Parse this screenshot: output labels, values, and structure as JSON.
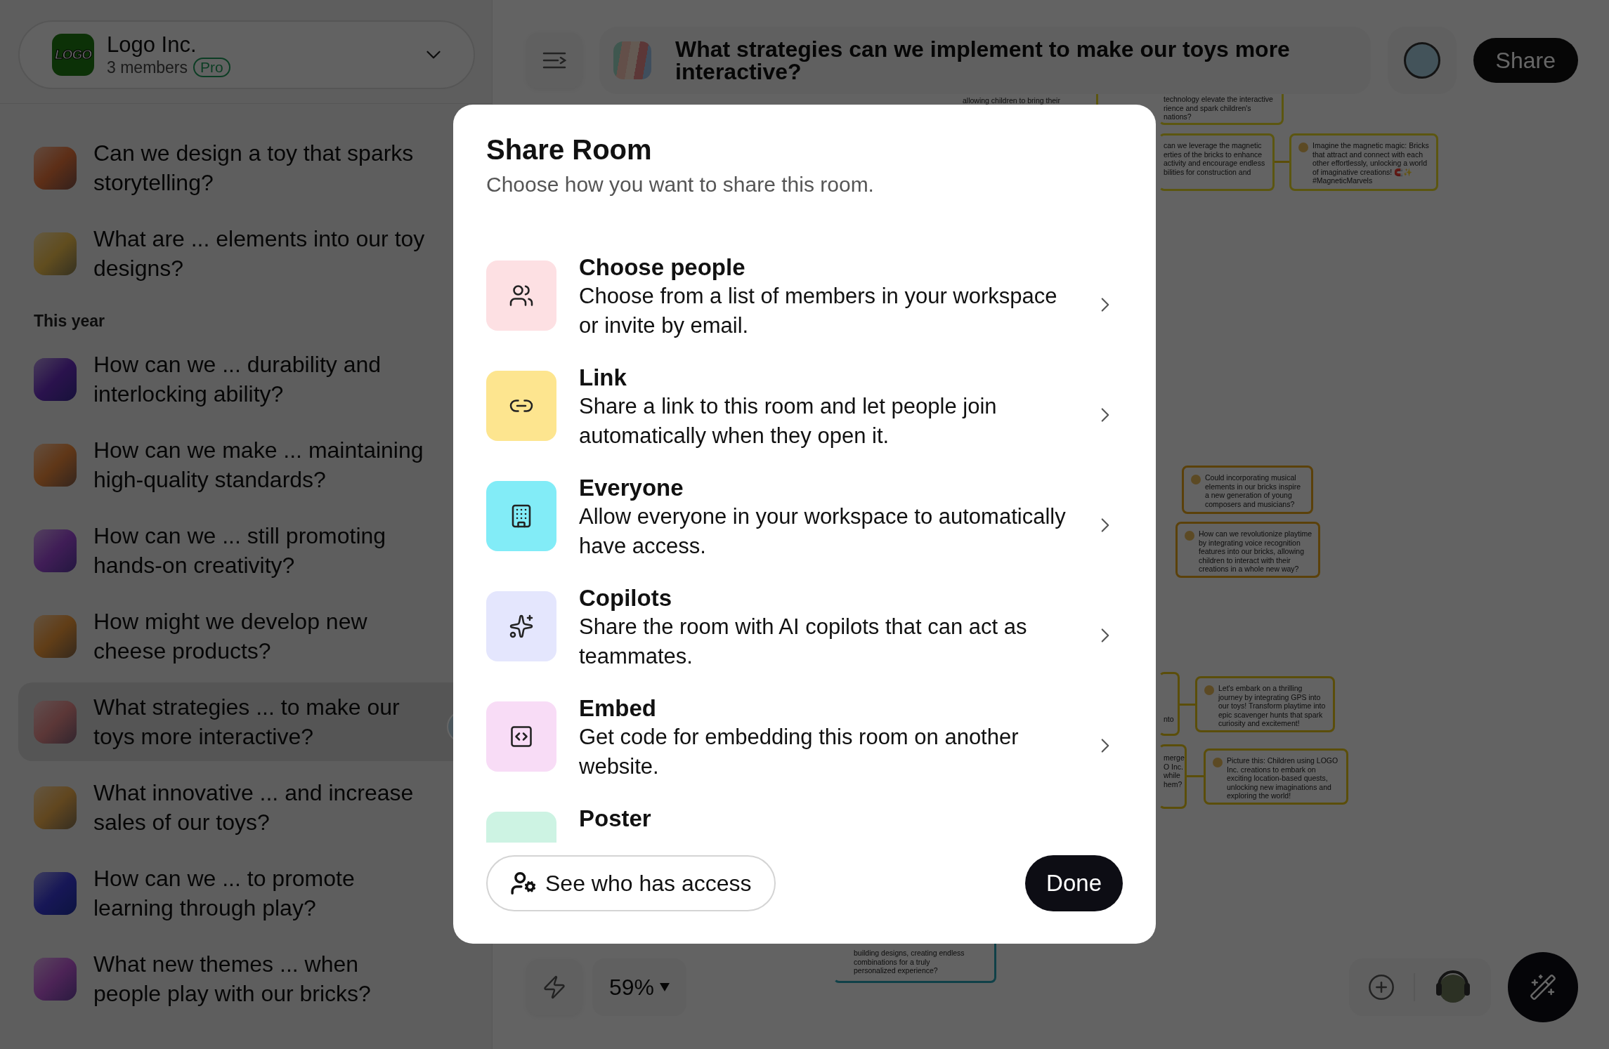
{
  "workspace": {
    "logo_text": "LOGO",
    "name": "Logo Inc.",
    "members": "3 members",
    "plan": "Pro"
  },
  "sidebar": {
    "sections": [
      {
        "items": [
          {
            "title": "Can we design a toy that sparks storytelling?",
            "selected": false
          },
          {
            "title": "What are ... elements into our toy designs?",
            "selected": false
          }
        ]
      },
      {
        "label": "This year",
        "items": [
          {
            "title": "How can we ... durability and interlocking ability?",
            "selected": false
          },
          {
            "title": "How can we make ... maintaining high-quality standards?",
            "selected": false
          },
          {
            "title": "How can we ... still promoting hands-on creativity?",
            "selected": false
          },
          {
            "title": "How might we develop new cheese products?",
            "selected": false
          },
          {
            "title": "What strategies ... to make our toys more interactive?",
            "selected": true
          },
          {
            "title": "What innovative ... and increase sales of our toys?",
            "selected": false
          },
          {
            "title": "How can we ... to promote learning through play?",
            "selected": false
          },
          {
            "title": "What new themes ... when people play with our bricks?",
            "selected": false
          }
        ]
      }
    ]
  },
  "header": {
    "title": "What strategies can we implement to make our toys more interactive?",
    "share": "Share"
  },
  "canvas": {
    "nodes": [
      {
        "kind": "fragment",
        "lines": [
          "allowing children to bring their"
        ]
      },
      {
        "kind": "fragment",
        "lines": [
          "technology elevate the interactive",
          "rience and spark children's",
          "nations?"
        ]
      },
      {
        "kind": "fragment",
        "lines": [
          "can we leverage the magnetic",
          "erties of the bricks to enhance",
          "activity and encourage endless",
          "bilities for construction and"
        ]
      },
      {
        "kind": "idea",
        "lines": [
          "Imagine the magnetic magic: Bricks that attract and connect with each other effortlessly, unlocking a world of imaginative creations! 🧲✨ #MagneticMarvels"
        ]
      },
      {
        "kind": "idea",
        "lines": [
          "Could incorporating musical elements in our bricks inspire a new generation of young composers and musicians?"
        ]
      },
      {
        "kind": "idea",
        "lines": [
          "How can we revolutionize playtime by integrating voice recognition features into our bricks, allowing children to interact with their creations in a whole new way?"
        ]
      },
      {
        "kind": "fragment",
        "lines": [
          "nto"
        ]
      },
      {
        "kind": "fragment",
        "lines": [
          "merge",
          "O Inc.",
          "while",
          "hem?"
        ]
      },
      {
        "kind": "idea",
        "lines": [
          "Let's embark on a thrilling journey by integrating GPS into our toys! Transform playtime into epic scavenger hunts that spark curiosity and excitement!"
        ]
      },
      {
        "kind": "idea",
        "lines": [
          "Picture this: Children using LOGO Inc. creations to embark on exciting location-based quests, unlocking new imaginations and exploring the world!"
        ]
      },
      {
        "kind": "fragment",
        "lines": [
          "building designs, creating endless",
          "combinations for a truly",
          "personalized experience?"
        ]
      }
    ],
    "zoom": "59%"
  },
  "dialog": {
    "title": "Share Room",
    "subtitle": "Choose how you want to share this room.",
    "options": [
      {
        "title": "Choose people",
        "description": "Choose from a list of members in your workspace or invite by email.",
        "color": "#fde0e3"
      },
      {
        "title": "Link",
        "description": "Share a link to this room and let people join automatically when they open it.",
        "color": "#fde58f"
      },
      {
        "title": "Everyone",
        "description": "Allow everyone in your workspace to automatically have access.",
        "color": "#82ecf7"
      },
      {
        "title": "Copilots",
        "description": "Share the room with AI copilots that can act as teammates.",
        "color": "#e4e6fd"
      },
      {
        "title": "Embed",
        "description": "Get code for embedding this room on another website.",
        "color": "#f8dcf6"
      },
      {
        "title": "Poster",
        "color": "#cdf3e3"
      }
    ],
    "access_button": "See who has access",
    "done_button": "Done"
  }
}
